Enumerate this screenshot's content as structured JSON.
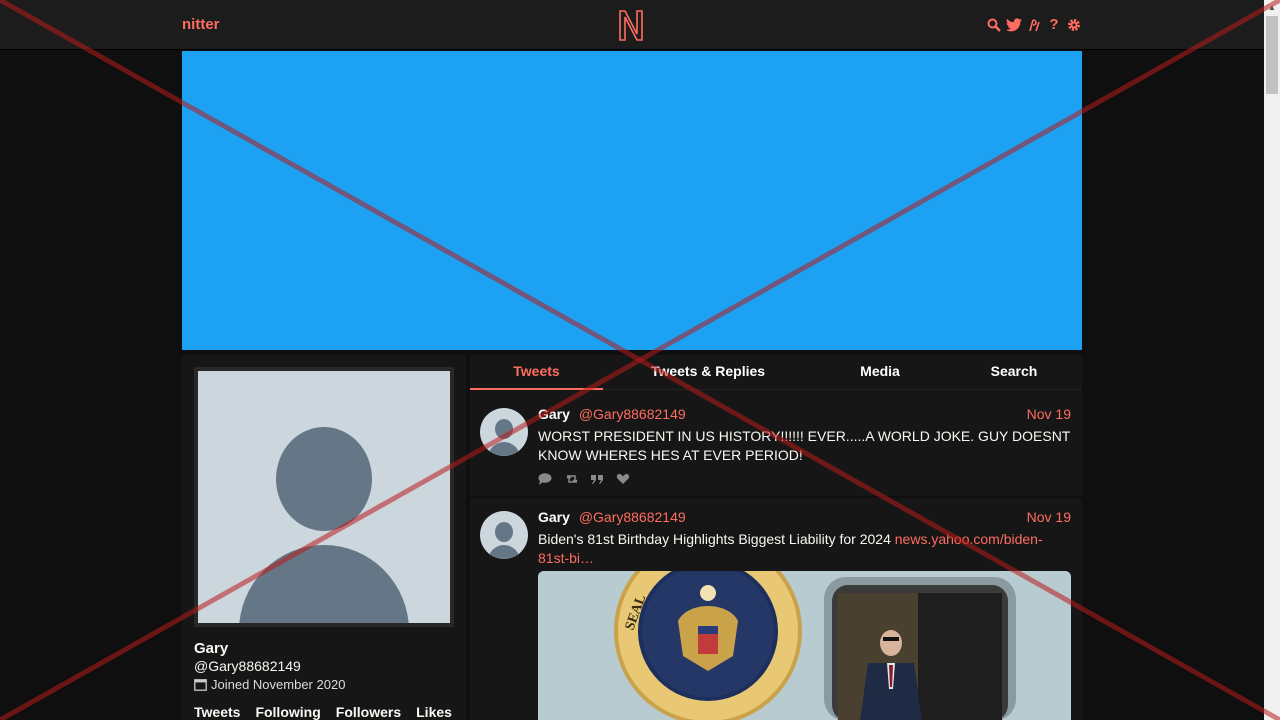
{
  "nav": {
    "brand": "nitter",
    "logo_letter": "N",
    "icons": [
      "search-icon",
      "twitter-bird-icon",
      "rss-icon",
      "help-icon",
      "gear-icon"
    ],
    "help_glyph": "?"
  },
  "colors": {
    "accent": "#ff6c60",
    "banner": "#1da1f2",
    "background": "#0f0f0f",
    "panel": "#161616"
  },
  "profile": {
    "name": "Gary",
    "handle": "@Gary88682149",
    "joined": "Joined November 2020",
    "stats": [
      "Tweets",
      "Following",
      "Followers",
      "Likes"
    ]
  },
  "tabs": [
    "Tweets",
    "Tweets & Replies",
    "Media",
    "Search"
  ],
  "active_tab": "Tweets",
  "tweets": [
    {
      "name": "Gary",
      "handle": "@Gary88682149",
      "date": "Nov 19",
      "text": "WORST PRESIDENT IN US HISTORY!!!!!! EVER.....A WORLD JOKE. GUY DOESNT KNOW WHERES HES AT EVER PERIOD!"
    },
    {
      "name": "Gary",
      "handle": "@Gary88682149",
      "date": "Nov 19",
      "text": "Biden's 81st Birthday Highlights Biggest Liability for 2024 ",
      "link": "news.yahoo.com/biden-81st-bi…"
    }
  ],
  "seal_text": "SEAL OF THE PRESIDENT OF THE UNITED STATES"
}
